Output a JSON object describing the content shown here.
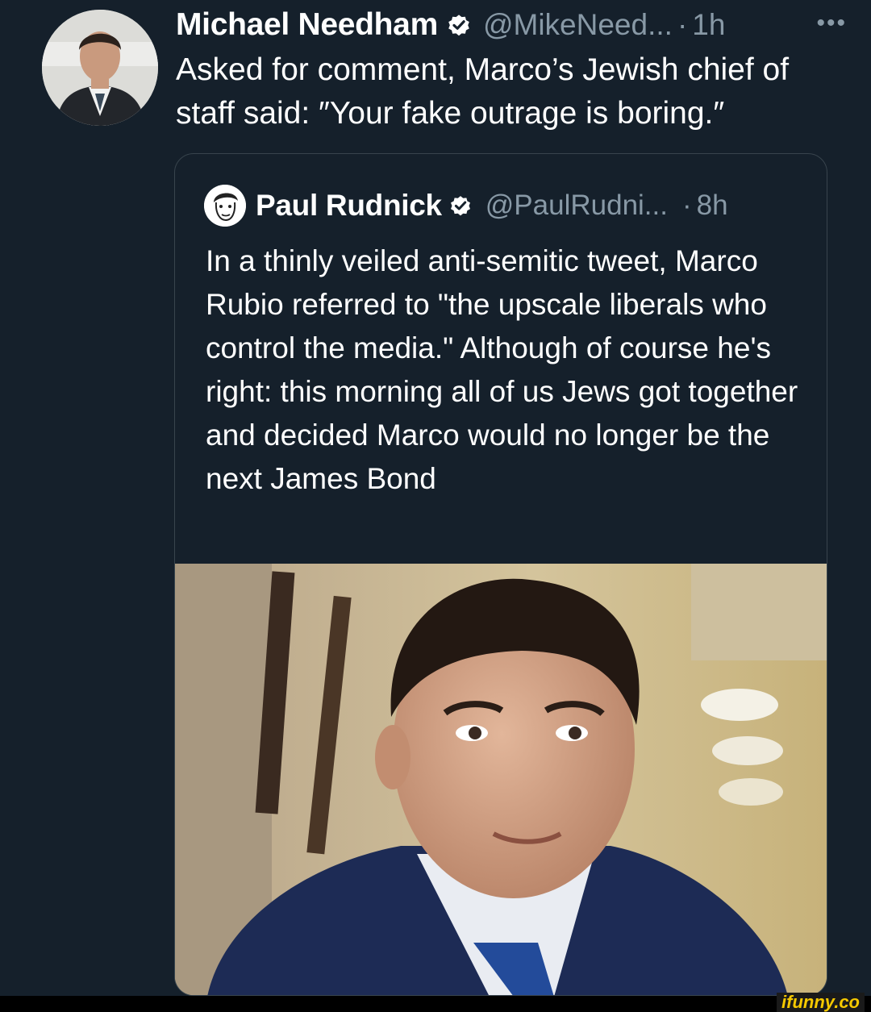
{
  "tweet": {
    "author_name": "Michael Needham",
    "handle": "@MikeNeed...",
    "separator": "·",
    "time": "1h",
    "more": "•••",
    "text": "Asked for comment, Marco’s Jewish chief of staff said: ″Your fake outrage is boring.″"
  },
  "quoted_tweet": {
    "author_name": "Paul Rudnick",
    "handle": "@PaulRudni...",
    "separator": "·",
    "time": "8h",
    "text": "In a thinly veiled anti-semitic tweet, Marco Rubio referred to \"the upscale liberals who control the media.\" Although of course he's right: this morning all of us Jews got together and decided Marco would no longer be the next James Bond"
  },
  "watermark": "ifunny.co",
  "colors": {
    "background": "#15202b",
    "secondary_text": "#8899a6",
    "border": "#38444d",
    "verified_badge": "#ffffff"
  },
  "icons": {
    "verified": "verified-badge-icon",
    "more": "more-dots-icon"
  }
}
